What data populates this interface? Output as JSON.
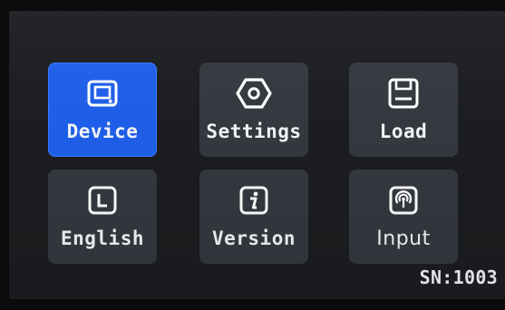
{
  "menu": {
    "items": [
      {
        "label": "Device",
        "icon": "device-screen-icon",
        "selected": true
      },
      {
        "label": "Settings",
        "icon": "hexagon-gear-icon",
        "selected": false
      },
      {
        "label": "Load",
        "icon": "save-disk-icon",
        "selected": false
      },
      {
        "label": "English",
        "icon": "language-l-icon",
        "selected": false
      },
      {
        "label": "Version",
        "icon": "info-icon",
        "selected": false
      },
      {
        "label": "Input",
        "icon": "signal-input-icon",
        "selected": false
      }
    ]
  },
  "footer": {
    "serial": "SN:1003"
  },
  "colors": {
    "selected_tile": "#1e5ee8",
    "tile": "#34383f",
    "background": "#1c1d20",
    "text": "#f2f3f5"
  }
}
